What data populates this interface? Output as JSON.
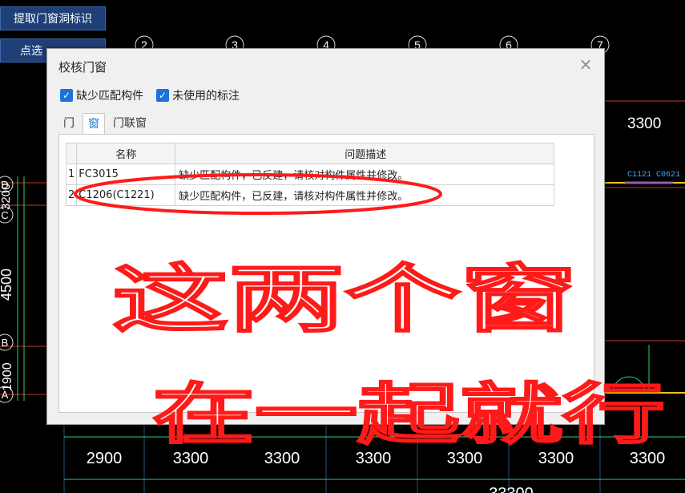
{
  "toolbar": {
    "extract_label": "提取门窗洞标识",
    "pick_label": "点选"
  },
  "cad": {
    "top_axis_numbers": [
      "2",
      "3",
      "4",
      "5",
      "6",
      "7"
    ],
    "left_axis_letters": [
      "D",
      "C",
      "B",
      "A"
    ],
    "left_dims": [
      "3200",
      "4500",
      "1900"
    ],
    "right_top_dim": "3300",
    "right_window_labels": "C1121  C0621",
    "bottom_dims": [
      "2900",
      "3300",
      "3300",
      "3300",
      "3300",
      "3300",
      "3300"
    ],
    "bottom_partial": "33300"
  },
  "dialog": {
    "title": "校核门窗",
    "close_symbol": "×",
    "check_missing_label": "缺少匹配构件",
    "check_unused_label": "未使用的标注",
    "tabs": [
      "门",
      "窗",
      "门联窗"
    ],
    "table": {
      "headers": [
        "名称",
        "问题描述"
      ],
      "rows": [
        {
          "index": "1",
          "name": "FC3015",
          "desc": "缺少匹配构件，已反建，请核对构件属性并修改。"
        },
        {
          "index": "2",
          "name": "C1206(C1221)",
          "desc": "缺少匹配构件，已反建，请核对构件属性并修改。"
        }
      ]
    }
  },
  "annotation": {
    "line1": "这两个窗",
    "line2": "在一起就行"
  },
  "colors": {
    "cad_background": "#000000",
    "grid_line": "#c0392b",
    "dim_line": "#2ecc71",
    "accent": "#1a73d9",
    "ink": "#ff1a1a"
  }
}
